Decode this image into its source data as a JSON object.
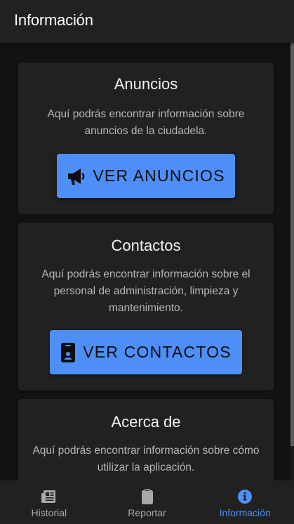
{
  "appbar": {
    "title": "Información"
  },
  "cards": [
    {
      "title": "Anuncios",
      "description": "Aquí podrás encontrar información sobre anuncios de la ciudadela.",
      "button_label": "VER ANUNCIOS",
      "button_icon": "megaphone-icon"
    },
    {
      "title": "Contactos",
      "description": "Aquí podrás encontrar información sobre el personal de administración, limpieza y mantenimiento.",
      "button_label": "VER CONTACTOS",
      "button_icon": "contact-badge-icon"
    },
    {
      "title": "Acerca de",
      "description": "Aquí podrás encontrar información sobre cómo utilizar la aplicación."
    }
  ],
  "bottom_nav": {
    "items": [
      {
        "label": "Historial",
        "icon": "newspaper-icon",
        "active": false
      },
      {
        "label": "Reportar",
        "icon": "clipboard-icon",
        "active": false
      },
      {
        "label": "Información",
        "icon": "info-circle-icon",
        "active": true
      }
    ]
  },
  "colors": {
    "background": "#121212",
    "surface": "#212121",
    "accent": "#4d8ff7",
    "text_secondary": "#b7b7b7"
  }
}
